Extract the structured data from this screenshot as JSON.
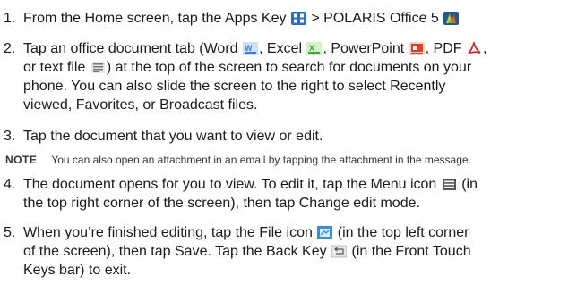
{
  "steps": [
    {
      "num": "1.",
      "t1": "From the Home screen, tap the ",
      "apps_key": "Apps Key",
      "t2": " > ",
      "app_name": "POLARIS Office 5"
    },
    {
      "num": "2.",
      "t1": "Tap an office document tab (",
      "word": "Word",
      "sep1": ", ",
      "excel": "Excel",
      "sep2": ", ",
      "ppt": "PowerPoint",
      "sep3": ", ",
      "pdf": "PDF",
      "sep4": ",",
      "line2a": "or ",
      "text_file": "text file",
      "line2b": ") at the top of the screen to search for documents on your",
      "line3": "phone. You can also slide the screen to the right to select ",
      "recent_a": "Recently",
      "recent_b": "viewed",
      "sep5": ", ",
      "favorites": "Favorites",
      "sep6": ", or ",
      "broadcast": "Broadcast",
      "t_end": " files."
    },
    {
      "num": "3.",
      "text": "Tap the document that you want to view or edit."
    },
    {
      "num": "4.",
      "t1": "The document opens for you to view. To edit it, tap the ",
      "menu": "Menu",
      "t2": " icon",
      "t3": " (in",
      "line2a": "the top right corner of the screen), then tap ",
      "change_mode": "Change edit mode",
      "line2b": "."
    },
    {
      "num": "5.",
      "t1": "When you’re finished editing, tap the ",
      "file": "File",
      "t2": " icon",
      "t3": " (in the top left corner",
      "line2a": "of the screen), then tap ",
      "save": "Save",
      "line2b": ". Tap the ",
      "back_key": "Back Key",
      "line2c": " (in the Front Touch",
      "line3": "Keys bar) to exit."
    }
  ],
  "note": {
    "tag": "NOTE",
    "text": "You can also open an attachment in an email by tapping the attachment in the message."
  },
  "icons": {
    "apps_key": "apps-grid-icon",
    "polaris": "polaris-office-icon",
    "word": "word-doc-icon",
    "excel": "excel-doc-icon",
    "ppt": "powerpoint-doc-icon",
    "pdf": "pdf-doc-icon",
    "text": "text-file-icon",
    "menu": "menu-icon",
    "file": "file-icon",
    "back": "back-key-icon"
  },
  "colors": {
    "text": "#1a1a1a",
    "apps_blue": "#2a6fc4",
    "word_blue": "#3b7fd4",
    "excel_green": "#3aa33a",
    "ppt_red": "#d9412b",
    "pdf_red": "#d22a2a"
  }
}
